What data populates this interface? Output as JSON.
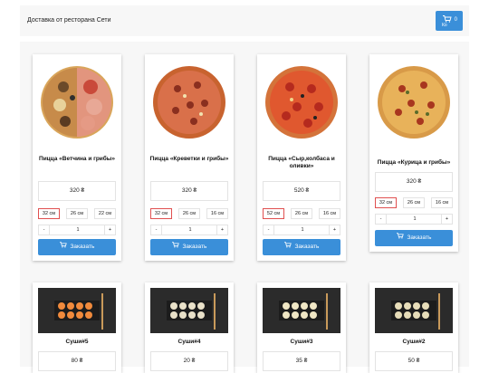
{
  "header": {
    "title": "Доставка от ресторана Сети",
    "cart_label": "Ко",
    "cart_count": "0"
  },
  "pizzas": [
    {
      "name": "Пицца «Ветчина и грибы»",
      "price": "320 ₴",
      "sizes": [
        "32 см",
        "26 см",
        "22 см"
      ],
      "selected_size": "32 см",
      "quantity": "1",
      "minus": "-",
      "plus": "+",
      "order_label": "Заказать"
    },
    {
      "name": "Пицца «Креветки и грибы»",
      "price": "320 ₴",
      "sizes": [
        "32 см",
        "26 см",
        "16 см"
      ],
      "selected_size": "32 см",
      "quantity": "1",
      "minus": "-",
      "plus": "+",
      "order_label": "Заказать"
    },
    {
      "name": "Пицца «Сыр,колбаса и оливки»",
      "price": "520 ₴",
      "sizes": [
        "52 см",
        "26 см",
        "16 см"
      ],
      "selected_size": "52 см",
      "quantity": "1",
      "minus": "-",
      "plus": "+",
      "order_label": "Заказать"
    },
    {
      "name": "Пицца «Курица и грибы»",
      "price": "320 ₴",
      "sizes": [
        "32 см",
        "26 см",
        "16 см"
      ],
      "selected_size": "32 см",
      "quantity": "1",
      "minus": "-",
      "plus": "+",
      "order_label": "Заказать"
    }
  ],
  "sushi": [
    {
      "name": "Суши#5",
      "price": "80 ₴"
    },
    {
      "name": "Суши#4",
      "price": "20 ₴"
    },
    {
      "name": "Суши#3",
      "price": "35 ₴"
    },
    {
      "name": "Суши#2",
      "price": "50 ₴"
    }
  ],
  "colors": {
    "accent": "#3a8fd9",
    "selected_size_border": "#e05050"
  }
}
